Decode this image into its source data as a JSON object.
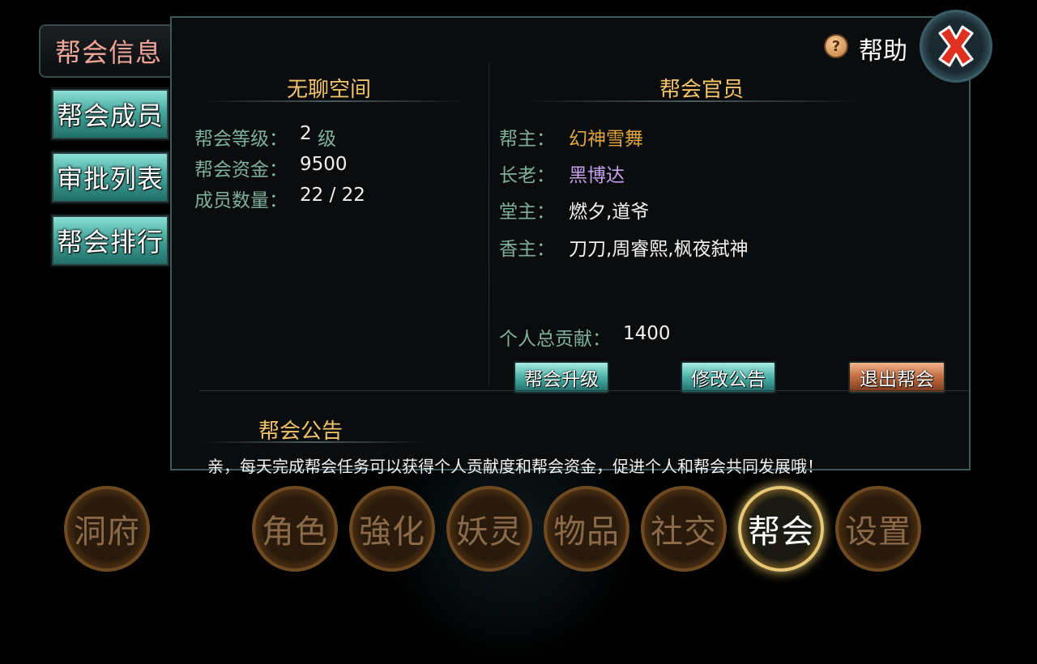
{
  "side_tabs": [
    {
      "label": "帮会信息",
      "active": true
    },
    {
      "label": "帮会成员",
      "active": false
    },
    {
      "label": "审批列表",
      "active": false
    },
    {
      "label": "帮会排行",
      "active": false
    }
  ],
  "header": {
    "help_label": "帮助",
    "help_icon": "question-icon",
    "close_icon": "close-x-icon"
  },
  "guild_info": {
    "name": "无聊空间",
    "level_label": "帮会等级：",
    "level_value": "2",
    "level_unit": "级",
    "funds_label": "帮会资金：",
    "funds_value": "9500",
    "members_label": "成员数量：",
    "members_value": "22 / 22"
  },
  "officials": {
    "title": "帮会官员",
    "leader_label": "帮主：",
    "leader_value": "幻神雪舞",
    "elder_label": "长老：",
    "elder_value": "黑博达",
    "hall_label": "堂主：",
    "hall_value": "燃夕,道爷",
    "incense_label": "香主：",
    "incense_value": "刀刀,周睿熙,枫夜弑神"
  },
  "contribution": {
    "label": "个人总贡献：",
    "value": "1400"
  },
  "buttons": {
    "upgrade": "帮会升级",
    "edit_notice": "修改公告",
    "leave": "退出帮会"
  },
  "notice": {
    "title": "帮会公告",
    "text": "亲，每天完成帮会任务可以获得个人贡献度和帮会资金，促进个人和帮会共同发展哦！"
  },
  "bottom_nav": [
    {
      "label": "洞府"
    },
    {
      "label": "角色"
    },
    {
      "label": "強化"
    },
    {
      "label": "妖灵"
    },
    {
      "label": "物品"
    },
    {
      "label": "社交"
    },
    {
      "label": "帮会",
      "active": true
    },
    {
      "label": "设置"
    }
  ],
  "colors": {
    "gold": "#f3c46a",
    "label": "#7fb09c",
    "leader": "#e0a640",
    "elder": "#c8a0f0",
    "teal_btn": "#4ab0a6",
    "orange_btn": "#c06a3e"
  }
}
